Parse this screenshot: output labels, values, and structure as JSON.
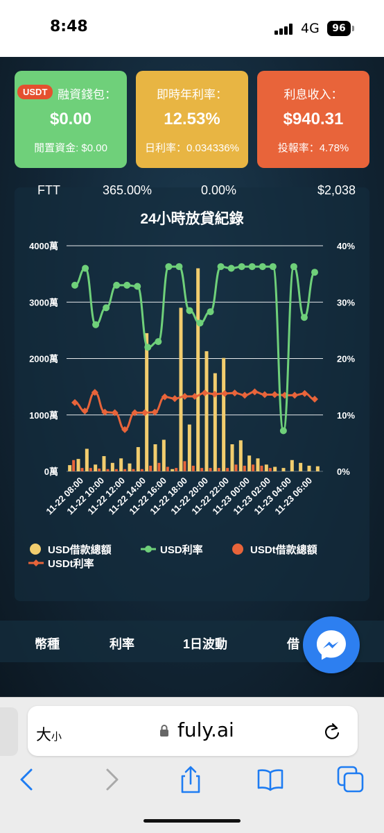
{
  "status": {
    "time": "8:48",
    "network": "4G",
    "battery": "96"
  },
  "cards": {
    "wallet": {
      "badge": "USDT",
      "title": "融資錢包：",
      "value": "$0.00",
      "sub": "閒置資金: $0.00",
      "color": "#6fd07a"
    },
    "rate": {
      "title": "即時年利率：",
      "value": "12.53%",
      "sub": "日利率：0.034336%",
      "color": "#e8b543"
    },
    "income": {
      "title": "利息收入：",
      "value": "$940.31",
      "sub": "投報率：4.78%",
      "color": "#e8643a"
    }
  },
  "chart_data": {
    "type": "bar",
    "title": "24小時放貸紀錄",
    "left_axis_ticks": [
      "0萬",
      "1000萬",
      "2000萬",
      "3000萬",
      "4000萬"
    ],
    "right_axis_ticks": [
      "0%",
      "10%",
      "20%",
      "30%",
      "40%"
    ],
    "ylim_left": [
      0,
      4000
    ],
    "ylim_right": [
      0,
      40
    ],
    "x_tick_labels": [
      "11-22 08:00",
      "11-22 10:00",
      "11-22 12:00",
      "11-22 14:00",
      "11-22 16:00",
      "11-22 18:00",
      "11-22 20:00",
      "11-22 22:00",
      "11-23 00:00",
      "11-23 02:00",
      "11-23 04:00",
      "11-23 06:00"
    ],
    "point_count": 30,
    "series": [
      {
        "name": "USD借款總額",
        "type": "bar",
        "color": "#f2cd6e",
        "axis": "left",
        "values": [
          110,
          220,
          400,
          120,
          270,
          150,
          230,
          140,
          430,
          2450,
          480,
          560,
          40,
          2900,
          830,
          3600,
          2130,
          1740,
          2010,
          480,
          550,
          280,
          230,
          120,
          80,
          60,
          200,
          150,
          100,
          90
        ]
      },
      {
        "name": "USD利率",
        "type": "line",
        "color": "#6fd07a",
        "axis": "right",
        "values": [
          33,
          36,
          26,
          29,
          33,
          33,
          32.8,
          22,
          23,
          36.3,
          36.3,
          28.5,
          26.3,
          28.3,
          36.3,
          36,
          36.3,
          36.3,
          36.3,
          36.3,
          7.2,
          36.3,
          27.3,
          35.3
        ]
      },
      {
        "name": "USDt借款總額",
        "type": "bar",
        "color": "#e8643a",
        "axis": "left",
        "values": [
          200,
          60,
          60,
          50,
          40,
          40,
          40,
          40,
          40,
          100,
          150,
          80,
          60,
          180,
          100,
          60,
          60,
          60,
          60,
          120,
          100,
          120,
          100,
          60
        ]
      },
      {
        "name": "USDt利率",
        "type": "line",
        "color": "#e8643a",
        "axis": "right",
        "values": [
          12.2,
          10.7,
          14,
          10.5,
          10.4,
          7.4,
          10.4,
          10.4,
          10.5,
          13.2,
          12.9,
          13.3,
          13.3,
          13.9,
          13.7,
          13.8,
          13.9,
          13.5,
          14.1,
          13.6,
          13.6,
          13.5,
          13.5,
          13.8,
          12.8
        ]
      }
    ],
    "legend": [
      "USD借款總額",
      "USD利率",
      "USDt借款總額",
      "USDt利率"
    ],
    "legend_position": "bottom",
    "grid": true
  },
  "table": {
    "headers": [
      "幣種",
      "利率",
      "1日波動",
      "借"
    ],
    "rows": [
      [
        "FTT",
        "365.00%",
        "0.00%",
        "$2,038"
      ]
    ]
  },
  "safari": {
    "text_size": "大",
    "text_size_small": "小",
    "url": "fuly.ai"
  },
  "icons": [
    "signal-icon",
    "battery-icon",
    "lock-icon",
    "reload-icon",
    "back-icon",
    "forward-icon",
    "share-icon",
    "bookmarks-icon",
    "tabs-icon",
    "messenger-icon"
  ]
}
